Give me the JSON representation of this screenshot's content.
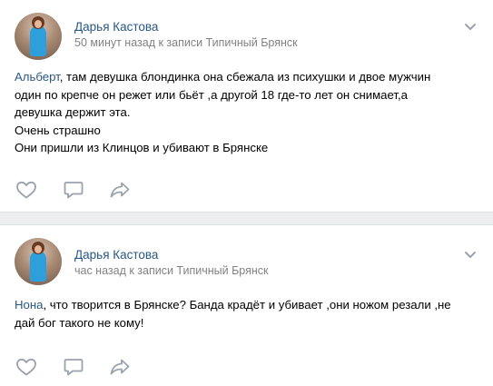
{
  "posts": [
    {
      "author": "Дарья Кастова",
      "meta": "50 минут назад к записи Типичный Брянск",
      "mention": "Альберт",
      "lines": [
        ", там девушка блондинка она сбежала из психушки и двое мужчин",
        "один по крепче он режет или бьёт ,а другой 18 где-то лет он снимает,а",
        "девушка держит эта.",
        "Очень страшно",
        "Они пришли из Клинцов и убивают в Брянске"
      ]
    },
    {
      "author": "Дарья Кастова",
      "meta": "час назад к записи Типичный Брянск",
      "mention": "Нона",
      "lines": [
        ", что творится в Брянске? Банда крадёт и убивает ,они ножом резали ,не",
        "дай бог такого не кому!"
      ]
    }
  ],
  "icons": {
    "like": "heart-icon",
    "comment": "comment-icon",
    "share": "share-arrow-icon",
    "menu": "chevron-down-icon"
  },
  "colors": {
    "link": "#2a5885",
    "meta": "#828282",
    "icon": "#99a2ad",
    "separator": "#edeef0"
  }
}
